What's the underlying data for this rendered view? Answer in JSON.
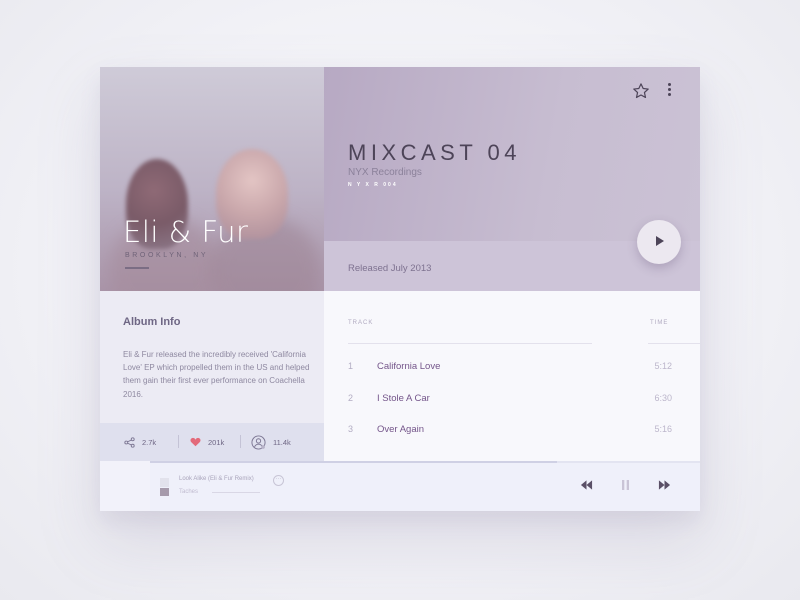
{
  "artist": {
    "name": "Eli & Fur",
    "location": "BROOKLYN, NY"
  },
  "album": {
    "title": "MIXCAST 04",
    "label": "NYX Recordings",
    "code": "N Y X R 004",
    "release": "Released July 2013"
  },
  "info": {
    "heading": "Album Info",
    "text": "Eli & Fur released the incredibly received 'California Love' EP which propelled them in the US and helped them gain their first ever performance on Coachella 2016."
  },
  "stats": {
    "shares": "2.7k",
    "likes": "201k",
    "listeners": "11.4k"
  },
  "tracklist": {
    "header_track": "TRACK",
    "header_time": "TIME",
    "tracks": [
      {
        "num": "1",
        "title": "California Love",
        "time": "5:12"
      },
      {
        "num": "2",
        "title": "I Stole A Car",
        "time": "6:30"
      },
      {
        "num": "3",
        "title": "Over Again",
        "time": "5:16"
      }
    ]
  },
  "player": {
    "now_playing_title": "Look Alike (Eli & Fur Remix)",
    "now_playing_artist": "Taches",
    "more_label": "···",
    "progress": 0.74
  },
  "icons": {
    "favorite": "star-icon",
    "more": "more-vertical-icon",
    "play": "play-icon",
    "share": "share-icon",
    "like": "heart-icon",
    "listeners": "user-icon",
    "rewind": "rewind-icon",
    "pause": "pause-icon",
    "forward": "fast-forward-icon"
  },
  "colors": {
    "accent": "#74558a",
    "heart": "#e36a7a",
    "hero": "#c4b8cf"
  }
}
